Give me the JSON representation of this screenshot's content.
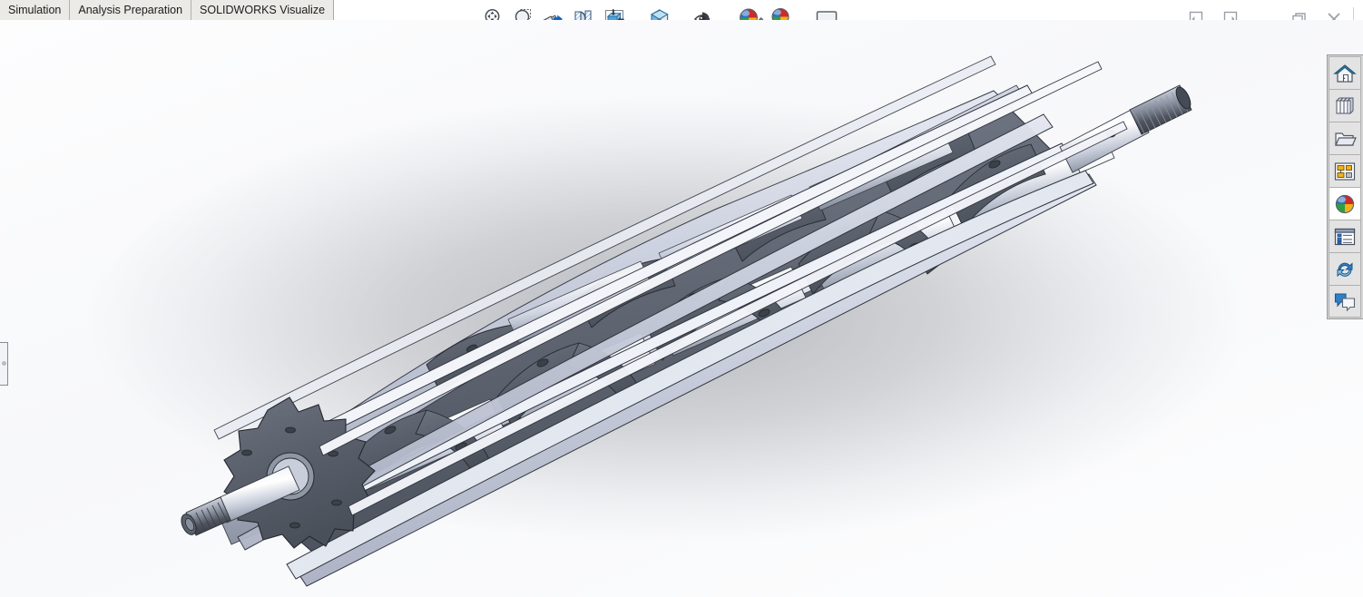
{
  "app": {
    "name": "SOLIDWORKS",
    "background_top": "#fdfdfe",
    "shadow_color": "#787c84"
  },
  "tabs": [
    {
      "label": "Simulation",
      "name": "tab-simulation"
    },
    {
      "label": "Analysis Preparation",
      "name": "tab-analysis-preparation"
    },
    {
      "label": "SOLIDWORKS Visualize",
      "name": "tab-solidworks-visualize"
    }
  ],
  "toolbar": {
    "items": [
      {
        "name": "zoom-to-fit-icon",
        "label": "Zoom to Fit",
        "dropdown": false
      },
      {
        "name": "zoom-to-area-icon",
        "label": "Zoom to Area",
        "dropdown": false
      },
      {
        "name": "previous-view-icon",
        "label": "Previous View",
        "dropdown": false
      },
      {
        "name": "section-view-icon",
        "label": "Section View",
        "dropdown": false
      },
      {
        "name": "view-orientation-icon",
        "label": "View Orientation",
        "dropdown": true
      },
      {
        "name": "display-style-icon",
        "label": "Display Style",
        "dropdown": true
      },
      {
        "name": "hide-show-items-icon",
        "label": "Hide/Show Items",
        "dropdown": true
      },
      {
        "name": "edit-appearance-icon",
        "label": "Edit Appearance",
        "dropdown": false
      },
      {
        "name": "apply-scene-icon",
        "label": "Apply Scene",
        "dropdown": true
      },
      {
        "name": "view-settings-icon",
        "label": "View Settings",
        "dropdown": true
      }
    ]
  },
  "window_controls": [
    {
      "name": "collapse-left-panel-button",
      "label": "Collapse Left Panel"
    },
    {
      "name": "expand-right-panel-button",
      "label": "Expand Right Panel"
    },
    {
      "name": "minimize-button",
      "label": "Minimize"
    },
    {
      "name": "restore-button",
      "label": "Restore Down"
    },
    {
      "name": "close-button",
      "label": "Close"
    }
  ],
  "task_pane": [
    {
      "name": "sidebar-item-solidworks-resources",
      "label": "SOLIDWORKS Resources",
      "icon": "home-icon",
      "active": false
    },
    {
      "name": "sidebar-item-design-library",
      "label": "Design Library",
      "icon": "design-library-icon",
      "active": false
    },
    {
      "name": "sidebar-item-file-explorer",
      "label": "File Explorer",
      "icon": "folder-icon",
      "active": false
    },
    {
      "name": "sidebar-item-view-palette",
      "label": "View Palette",
      "icon": "view-palette-icon",
      "active": false
    },
    {
      "name": "sidebar-item-appearances",
      "label": "Appearances, Scenes and Decals",
      "icon": "appearances-sphere-icon",
      "active": true
    },
    {
      "name": "sidebar-item-custom-properties",
      "label": "Custom Properties",
      "icon": "custom-properties-icon",
      "active": false
    },
    {
      "name": "sidebar-item-solidworks-forum",
      "label": "SOLIDWORKS Forum",
      "icon": "refresh-sync-icon",
      "active": false
    },
    {
      "name": "sidebar-item-comments",
      "label": "Comments",
      "icon": "speech-bubbles-icon",
      "active": false
    }
  ],
  "feature_manager_tab": {
    "name": "feature-manager-flyout-tab",
    "label": "FeatureManager"
  },
  "model": {
    "name": "rotor-auger-assembly",
    "description": "Shaded isometric view of a helical rotor / auger drum assembly",
    "axis_color": "#c9cbd6",
    "metal_light": "#e8eaf2",
    "metal_mid": "#b9bdcb",
    "metal_dark": "#575d68",
    "edge_color": "#2b2f36"
  }
}
